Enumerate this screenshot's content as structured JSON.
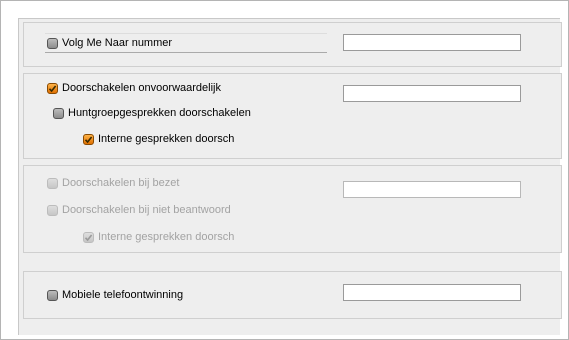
{
  "follow_me": {
    "label": "Volg Me Naar nummer",
    "checked": false,
    "value": ""
  },
  "forward": {
    "unconditional_label": "Doorschakelen onvoorwaardelijk",
    "unconditional_checked": true,
    "unconditional_value": "",
    "huntgroup_label": "Huntgroepgesprekken doorschakelen",
    "huntgroup_checked": false,
    "internal_label": "Interne gesprekken doorsch",
    "internal_checked": true
  },
  "busy": {
    "busy_label": "Doorschakelen bij bezet",
    "busy_value": "",
    "noanswer_label": "Doorschakelen bij niet beantwoord",
    "internal_label": "Interne gesprekken doorsch",
    "internal_checked": true,
    "disabled": true
  },
  "mobile": {
    "label": "Mobiele telefoontwinning",
    "checked": false,
    "value": ""
  }
}
